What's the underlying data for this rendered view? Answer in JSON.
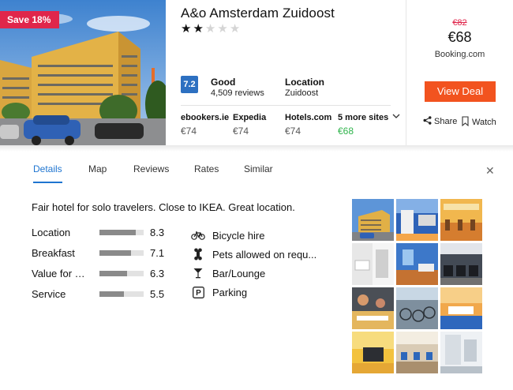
{
  "hotel": {
    "name": "A&o Amsterdam Zuidoost",
    "stars": 2,
    "stars_total": 5,
    "save_badge": "Save 18%",
    "rating": {
      "score": "7.2",
      "word": "Good",
      "reviews": "4,509 reviews"
    },
    "location": {
      "title": "Location",
      "value": "Zuidoost"
    }
  },
  "providers": [
    {
      "name": "ebookers.ie",
      "price": "€74"
    },
    {
      "name": "Expedia",
      "price": "€74"
    },
    {
      "name": "Hotels.com",
      "price": "€74"
    },
    {
      "name": "5 more sites",
      "price": "€68"
    }
  ],
  "deal": {
    "old_price": "€82",
    "price": "€68",
    "site": "Booking.com",
    "button": "View Deal",
    "share": "Share",
    "watch": "Watch"
  },
  "tabs": [
    "Details",
    "Map",
    "Reviews",
    "Rates",
    "Similar"
  ],
  "active_tab": "Details",
  "details": {
    "summary": "Fair hotel for solo travelers. Close to IKEA. Great location.",
    "scores": [
      {
        "label": "Location",
        "value": "8.3",
        "fraction": 0.83
      },
      {
        "label": "Breakfast",
        "value": "7.1",
        "fraction": 0.71
      },
      {
        "label": "Value for …",
        "value": "6.3",
        "fraction": 0.63
      },
      {
        "label": "Service",
        "value": "5.5",
        "fraction": 0.55
      }
    ],
    "amenities": [
      {
        "icon": "bicycle-icon",
        "label": "Bicycle hire"
      },
      {
        "icon": "bone-icon",
        "label": "Pets allowed on requ..."
      },
      {
        "icon": "cocktail-icon",
        "label": "Bar/Lounge"
      },
      {
        "icon": "parking-icon",
        "label": "Parking"
      }
    ]
  },
  "colors": {
    "accent_blue": "#1f75d0",
    "deal_orange": "#f2531f",
    "badge_red": "#e0264b",
    "rating_blue": "#2d70c1",
    "green_price": "#2fb44c"
  }
}
